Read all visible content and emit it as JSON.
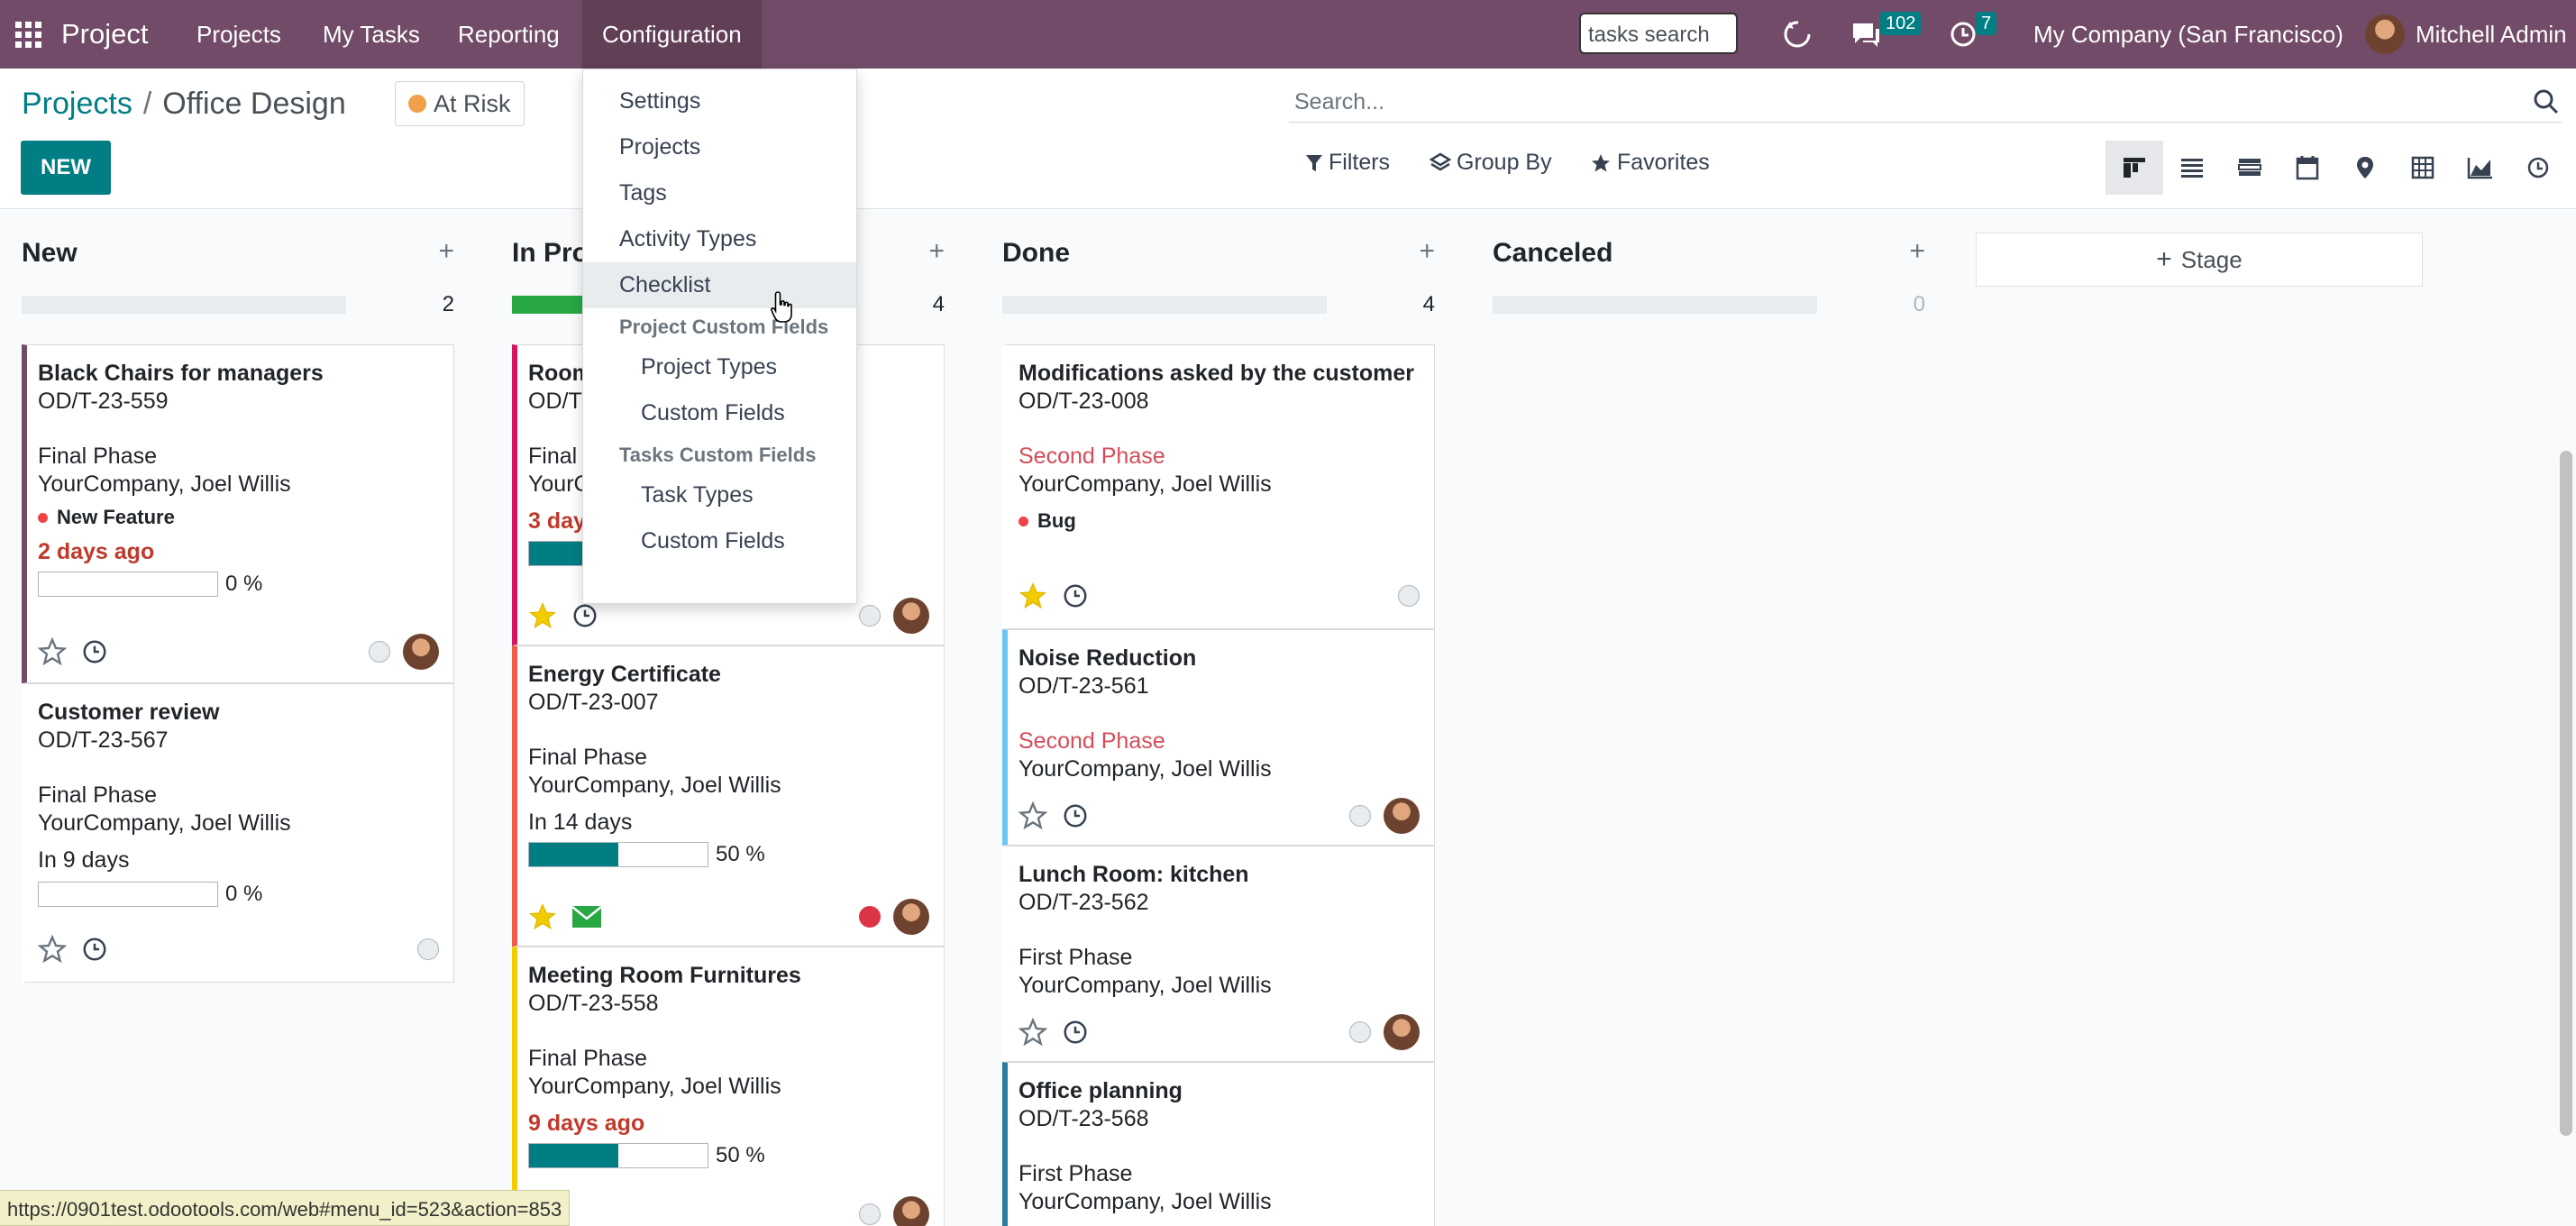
{
  "topbar": {
    "app_name": "Project",
    "menu": [
      "Projects",
      "My Tasks",
      "Reporting",
      "Configuration"
    ],
    "search_value": "tasks search",
    "messages_count": "102",
    "activities_count": "7",
    "company": "My Company (San Francisco)",
    "user": "Mitchell Admin",
    "color": "#714b67"
  },
  "control_panel": {
    "breadcrumb_parent": "Projects",
    "breadcrumb_separator": "/",
    "breadcrumb_current": "Office Design",
    "status": "At Risk",
    "new_button": "NEW",
    "search_placeholder": "Search...",
    "filters": "Filters",
    "group_by": "Group By",
    "favorites": "Favorites",
    "views": [
      "kanban-icon",
      "list-icon",
      "gantt-icon",
      "calendar-icon",
      "map-icon",
      "pivot-icon",
      "graph-icon",
      "activity-icon"
    ]
  },
  "config_menu": {
    "items": [
      "Settings",
      "Projects",
      "Tags",
      "Activity Types",
      "Checklist"
    ],
    "section1": "Project Custom Fields",
    "section1_items": [
      "Project Types",
      "Custom Fields"
    ],
    "section2": "Tasks Custom Fields",
    "section2_items": [
      "Task Types",
      "Custom Fields"
    ],
    "hovered": "Checklist"
  },
  "columns": [
    {
      "name": "New",
      "count": "2",
      "progress": 0
    },
    {
      "name": "In Progress",
      "visible_name": "In Pro",
      "count": "4",
      "progress": 0.25
    },
    {
      "name": "Done",
      "count": "4",
      "progress": 0
    },
    {
      "name": "Canceled",
      "count": "0",
      "progress": 0
    }
  ],
  "add_stage": "Stage",
  "cards": {
    "new": [
      {
        "title": "Black Chairs for managers",
        "ref": "OD/T-23-559",
        "phase": "Final Phase",
        "company": "YourCompany, Joel Willis",
        "tag": "New Feature",
        "deadline": "2 days ago",
        "progress": "0 %",
        "progress_value": 0
      },
      {
        "title": "Customer review",
        "ref": "OD/T-23-567",
        "phase": "Final Phase",
        "company": "YourCompany, Joel Willis",
        "deadline": "In 9 days",
        "progress": "0 %",
        "progress_value": 0
      }
    ],
    "in_progress": [
      {
        "title": "Room",
        "ref": "OD/T",
        "phase": "Final",
        "company": "YourC",
        "deadline": "3 day",
        "progress_value": 0.5
      },
      {
        "title": "Energy Certificate",
        "ref": "OD/T-23-007",
        "phase": "Final Phase",
        "company": "YourCompany, Joel Willis",
        "deadline": "In 14 days",
        "progress": "50 %",
        "progress_value": 0.5
      },
      {
        "title": "Meeting Room Furnitures",
        "ref": "OD/T-23-558",
        "phase": "Final Phase",
        "company": "YourCompany, Joel Willis",
        "deadline": "9 days ago",
        "progress": "50 %",
        "progress_value": 0.5
      }
    ],
    "done": [
      {
        "title": "Modifications asked by the customer",
        "ref": "OD/T-23-008",
        "phase": "Second Phase",
        "company": "YourCompany, Joel Willis",
        "tag": "Bug"
      },
      {
        "title": "Noise Reduction",
        "ref": "OD/T-23-561",
        "phase": "Second Phase",
        "company": "YourCompany, Joel Willis"
      },
      {
        "title": "Lunch Room: kitchen",
        "ref": "OD/T-23-562",
        "phase": "First Phase",
        "company": "YourCompany, Joel Willis"
      },
      {
        "title": "Office planning",
        "ref": "OD/T-23-568",
        "phase": "First Phase",
        "company": "YourCompany, Joel Willis"
      }
    ]
  },
  "status_url": "https://0901test.odootools.com/web#menu_id=523&action=853"
}
